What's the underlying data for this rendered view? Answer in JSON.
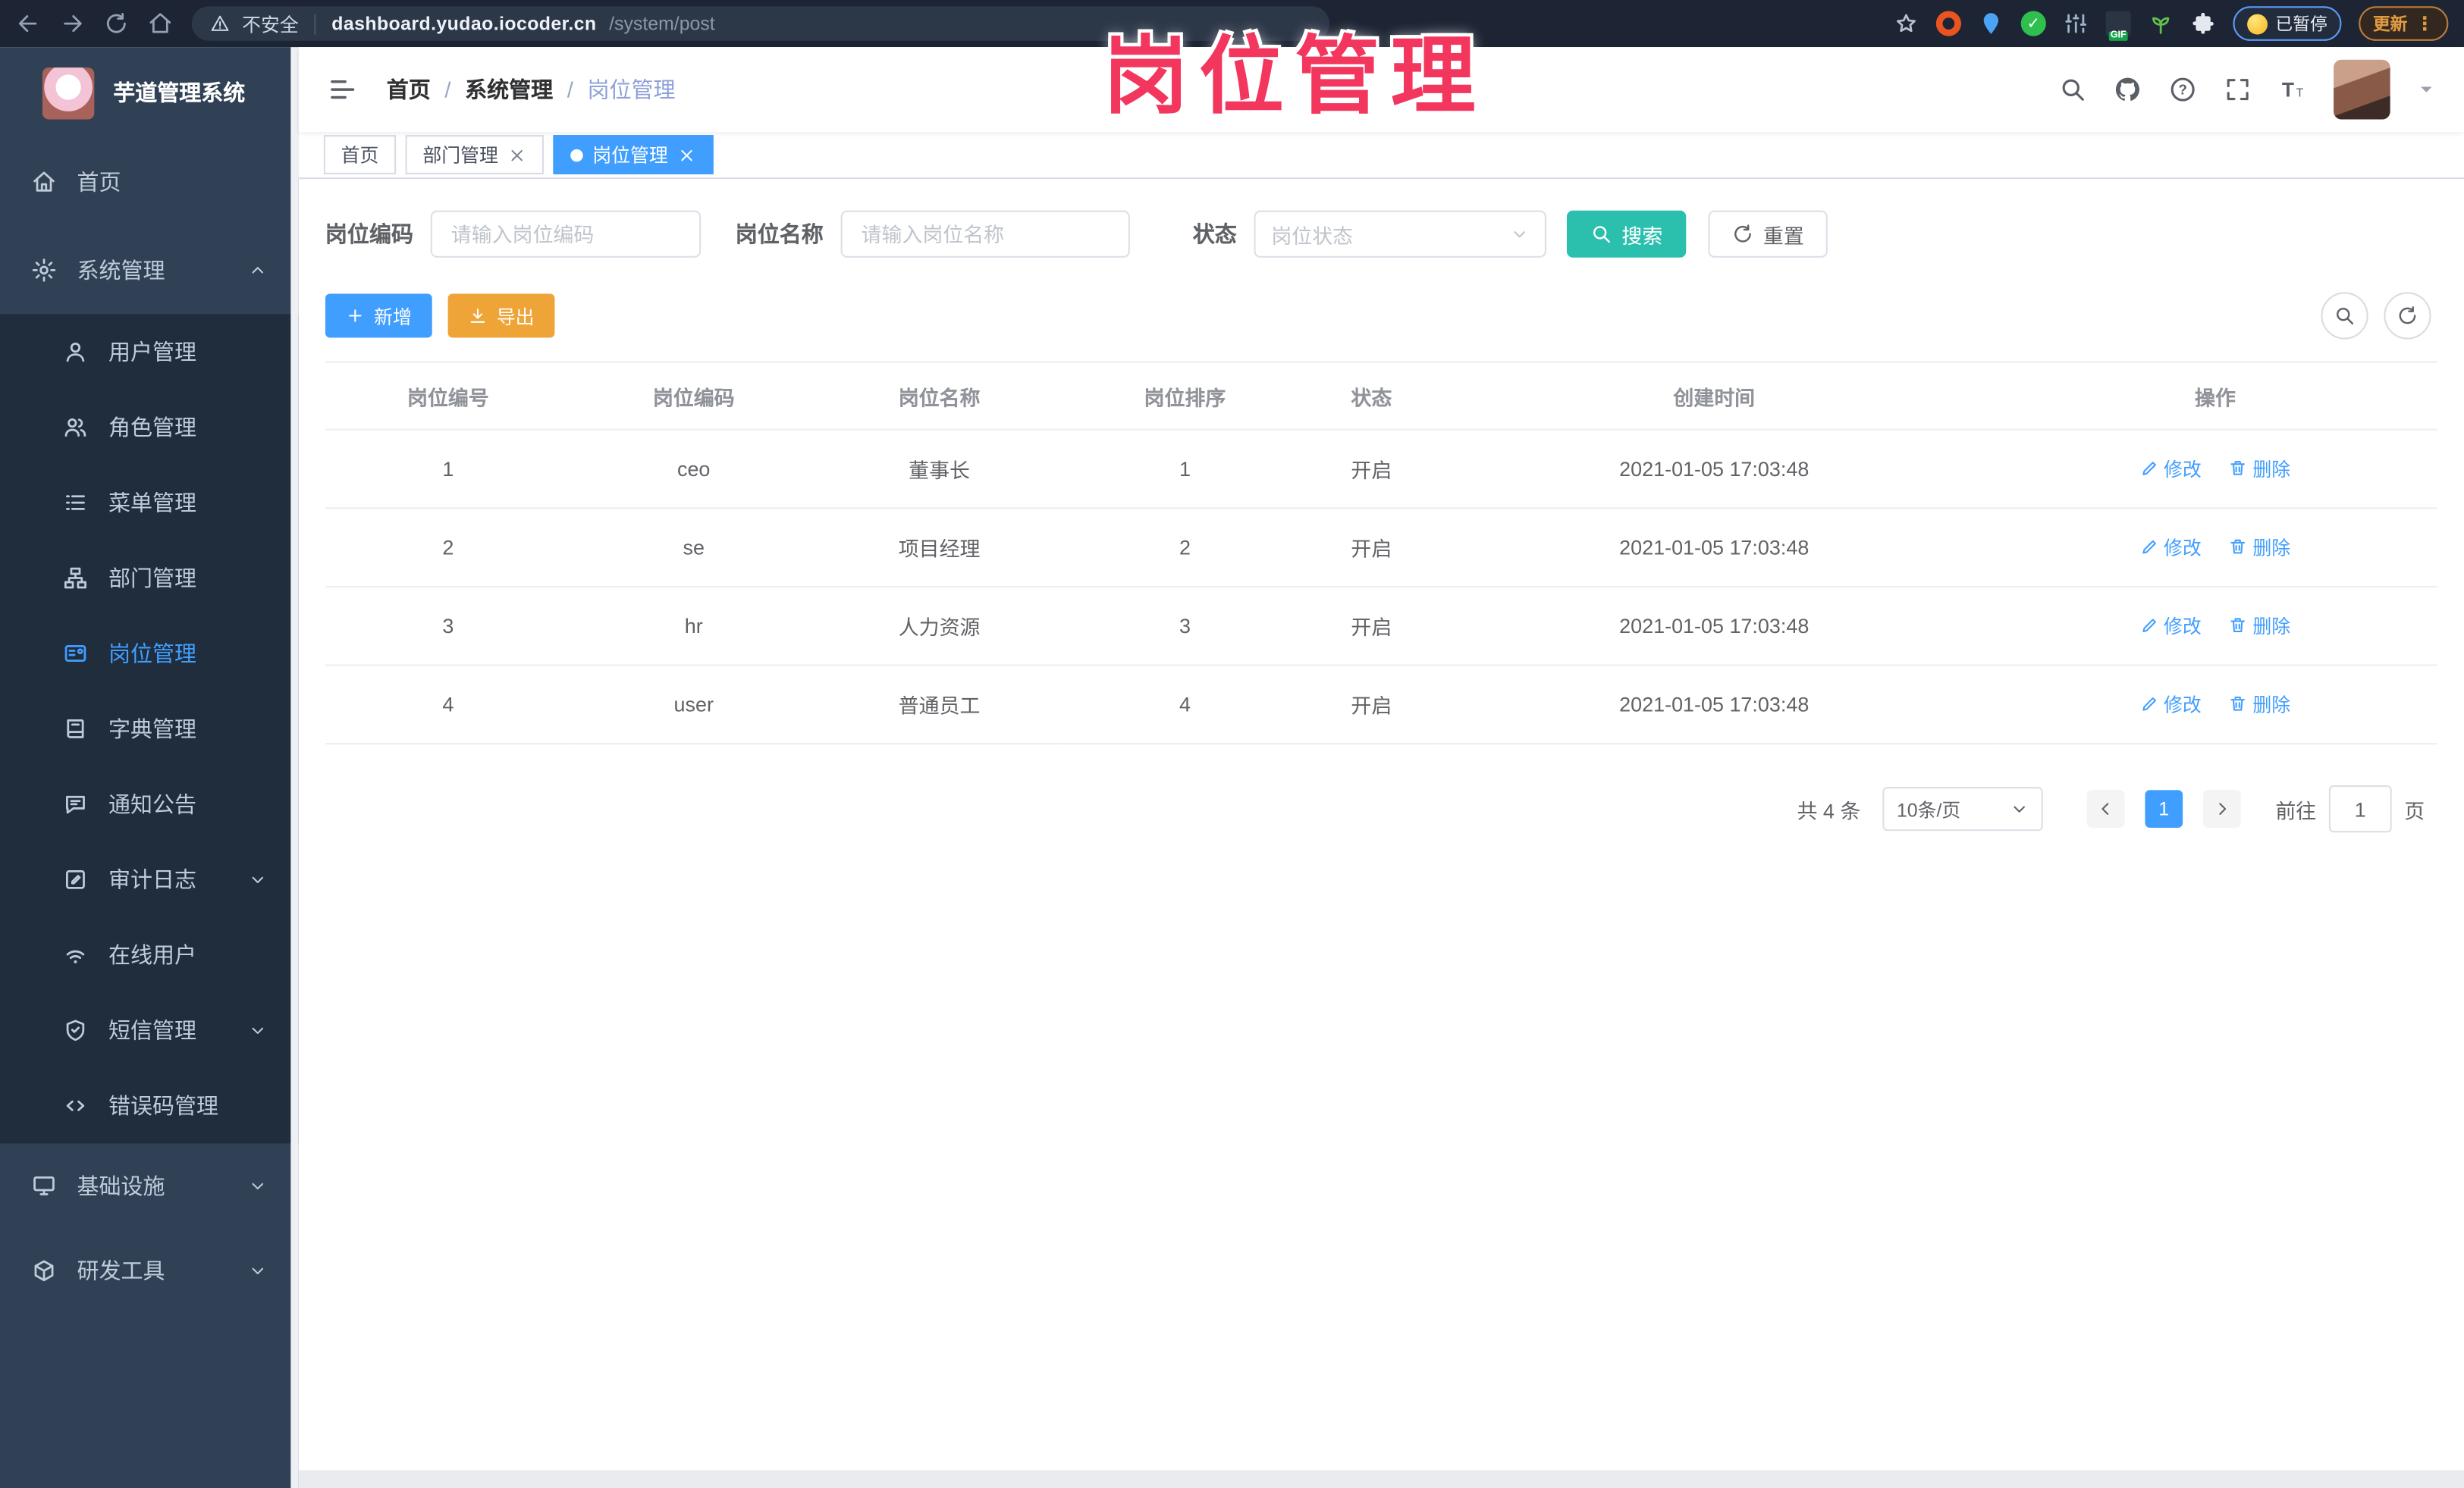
{
  "overlay_title": "岗位管理",
  "browser": {
    "nav_icons": [
      "back-icon",
      "forward-icon",
      "reload-icon",
      "home-icon"
    ],
    "security_label": "不安全",
    "url_host": "dashboard.yudao.iocoder.cn",
    "url_path": "/system/post",
    "bookmark_icon": "star-icon",
    "extension_icons": [
      "ubuntu-ring-icon",
      "location-pin-icon",
      "green-check-icon",
      "sliders-icon",
      "gif-badge-icon",
      "plant-icon",
      "extensions-puzzle-icon"
    ],
    "paused_badge": "已暂停",
    "update_button": "更新"
  },
  "sidebar": {
    "logo_title": "芋道管理系统",
    "items": [
      {
        "label": "首页",
        "icon": "home-menu-icon"
      },
      {
        "label": "系统管理",
        "icon": "gear-icon",
        "chevron": "up"
      },
      {
        "label": "用户管理",
        "icon": "user-icon"
      },
      {
        "label": "角色管理",
        "icon": "role-icon"
      },
      {
        "label": "菜单管理",
        "icon": "menu-list-icon"
      },
      {
        "label": "部门管理",
        "icon": "org-tree-icon"
      },
      {
        "label": "岗位管理",
        "icon": "postcard-icon",
        "active": true
      },
      {
        "label": "字典管理",
        "icon": "dictionary-icon"
      },
      {
        "label": "通知公告",
        "icon": "announcement-icon"
      },
      {
        "label": "审计日志",
        "icon": "audit-log-icon",
        "chevron": "down"
      },
      {
        "label": "在线用户",
        "icon": "online-users-icon"
      },
      {
        "label": "短信管理",
        "icon": "shield-icon",
        "chevron": "down"
      },
      {
        "label": "错误码管理",
        "icon": "code-icon"
      },
      {
        "label": "基础设施",
        "icon": "monitor-icon",
        "chevron": "down"
      },
      {
        "label": "研发工具",
        "icon": "toolbox-icon",
        "chevron": "down"
      }
    ]
  },
  "header": {
    "menu_icon": "hamburger-icon",
    "breadcrumb": [
      "首页",
      "系统管理",
      "岗位管理"
    ],
    "breadcrumb_separator": "/",
    "action_icons": [
      "search-icon",
      "github-icon",
      "help-icon",
      "fullscreen-icon",
      "font-size-icon",
      "user-avatar",
      "caret-down-icon"
    ]
  },
  "tabs": [
    {
      "label": "首页",
      "closable": false,
      "active": false
    },
    {
      "label": "部门管理",
      "closable": true,
      "active": false
    },
    {
      "label": "岗位管理",
      "closable": true,
      "active": true
    }
  ],
  "filters": {
    "post_code": {
      "label": "岗位编码",
      "placeholder": "请输入岗位编码"
    },
    "post_name": {
      "label": "岗位名称",
      "placeholder": "请输入岗位名称"
    },
    "status": {
      "label": "状态",
      "placeholder": "岗位状态"
    },
    "search_button": "搜索",
    "reset_button": "重置"
  },
  "toolbar": {
    "add_button": "新增",
    "export_button": "导出",
    "icon_buttons": [
      "search-toggle-icon",
      "refresh-icon"
    ]
  },
  "table": {
    "headers": [
      "岗位编号",
      "岗位编码",
      "岗位名称",
      "岗位排序",
      "状态",
      "创建时间",
      "操作"
    ],
    "action_edit": "修改",
    "action_delete": "删除",
    "rows": [
      {
        "id": "1",
        "code": "ceo",
        "name": "董事长",
        "sort": "1",
        "status": "开启",
        "created": "2021-01-05 17:03:48"
      },
      {
        "id": "2",
        "code": "se",
        "name": "项目经理",
        "sort": "2",
        "status": "开启",
        "created": "2021-01-05 17:03:48"
      },
      {
        "id": "3",
        "code": "hr",
        "name": "人力资源",
        "sort": "3",
        "status": "开启",
        "created": "2021-01-05 17:03:48"
      },
      {
        "id": "4",
        "code": "user",
        "name": "普通员工",
        "sort": "4",
        "status": "开启",
        "created": "2021-01-05 17:03:48"
      }
    ]
  },
  "pagination": {
    "total": "共 4 条",
    "page_size": "10条/页",
    "current_page": "1",
    "goto_label": "前往",
    "goto_value": "1",
    "page_unit": "页"
  },
  "colors": {
    "accent": "#409eff",
    "search_button": "#2bbfae",
    "export_button": "#efa437",
    "overlay_title": "#f2365e",
    "sidebar_bg": "#304156",
    "submenu_bg": "#1f2d3d",
    "browser_bar_bg": "#1d2534"
  }
}
